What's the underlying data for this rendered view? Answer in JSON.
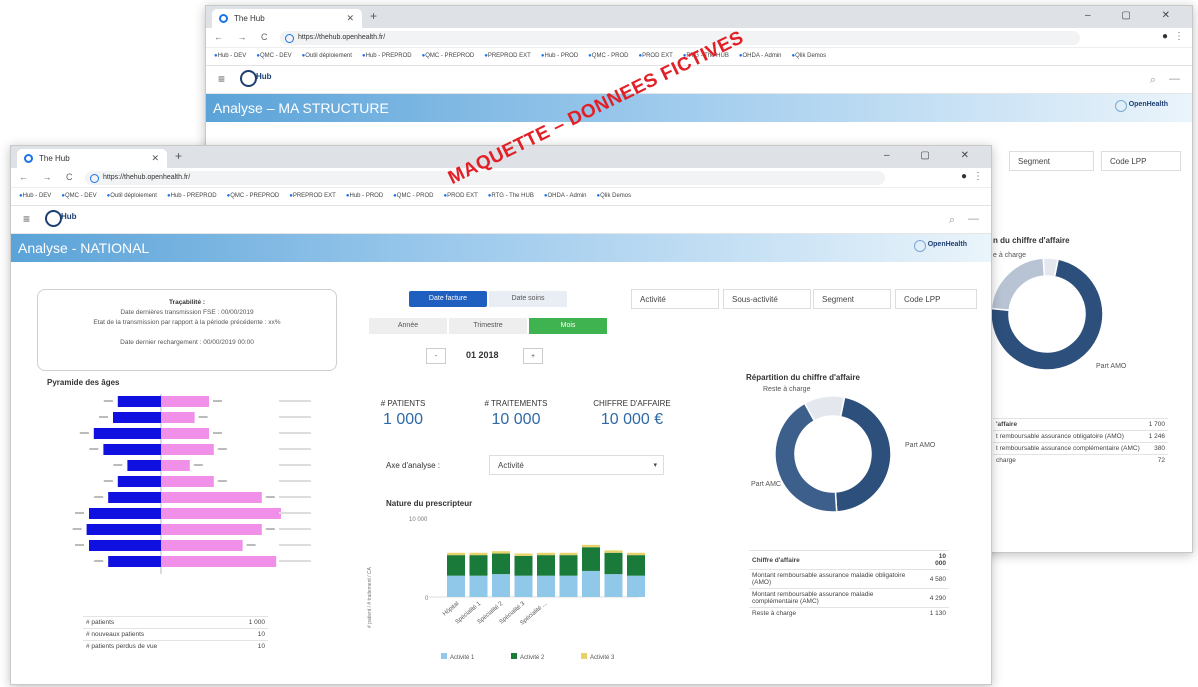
{
  "browser": {
    "tab_title": "The Hub",
    "url": "https://thehub.openhealth.fr/",
    "bookmarks": [
      "Hub - DEV",
      "QMC - DEV",
      "Outil déploiement",
      "Hub - PREPROD",
      "QMC - PREPROD",
      "PREPROD EXT",
      "Hub - PROD",
      "QMC - PROD",
      "PROD EXT",
      "RTG - The HUB",
      "OHDA - Admin",
      "Qlik Demos"
    ]
  },
  "app": {
    "logo_text": "Hub",
    "brand_text": "OpenHealth"
  },
  "back": {
    "title": "Analyse – MA STRUCTURE",
    "filters": [
      "Segment",
      "Code LPP"
    ],
    "chart_title": "n du chiffre d'affaire",
    "reste_label": "e à charge",
    "amo_label": "Part AMO",
    "table": [
      {
        "label": "'affaire",
        "value": "1 700"
      },
      {
        "label": "t remboursable assurance obligatoire (AMO)",
        "value": "1 246"
      },
      {
        "label": "t remboursable assurance complémentaire (AMC)",
        "value": "380"
      },
      {
        "label": "charge",
        "value": "72"
      }
    ]
  },
  "front": {
    "title": "Analyse - NATIONAL",
    "trace": {
      "heading": "Traçabilité :",
      "line1": "Date dernières transmission FSE : 00/00/2019",
      "line2": "Etat de la transmission par rapport à la période précédente : xx%",
      "line3": "Date dernier rechargement : 00/00/2019 00:00"
    },
    "toggle": {
      "left": "Date facture",
      "right": "Date soins"
    },
    "period": {
      "a": "Année",
      "b": "Trimestre",
      "c": "Mois"
    },
    "nav_value": "01 2018",
    "nav_prev": "-",
    "nav_next": "+",
    "filters": [
      "Activité",
      "Sous-activité",
      "Segment",
      "Code LPP"
    ],
    "pyramid_title": "Pyramide des âges",
    "kpis": [
      {
        "label": "# PATIENTS",
        "value": "1 000"
      },
      {
        "label": "# TRAITEMENTS",
        "value": "10 000"
      },
      {
        "label": "CHIFFRE D'AFFAIRE",
        "value": "10 000 €"
      }
    ],
    "axe_label": "Axe d'analyse :",
    "axe_value": "Activité",
    "presc_title": "Nature du prescripteur",
    "presc_ymax": "10 000",
    "presc_yzero": "0",
    "presc_ylabel": "# patient / # traitement / CA",
    "presc_categories": [
      "Hôpital",
      "Spécialité 1",
      "Spécialité 2",
      "Spécialité 3",
      "Spécialité ..."
    ],
    "legend": [
      "Activité 1",
      "Activité 2",
      "Activité 3"
    ],
    "repart_title": "Répartition du chiffre d'affaire",
    "reste_label": "Reste à charge",
    "amo_label": "Part AMO",
    "amc_label": "Part AMC",
    "ca_table": [
      {
        "label": "Chiffre d'affaire",
        "value": "10 000"
      },
      {
        "label": "Montant remboursable assurance maladie obligatoire (AMO)",
        "value": "4 580"
      },
      {
        "label": "Montant remboursable assurance maladie complémentaire (AMC)",
        "value": "4 290"
      },
      {
        "label": "Reste à charge",
        "value": "1 130"
      }
    ],
    "patients_table": [
      {
        "label": "# patients",
        "value": "1 000"
      },
      {
        "label": "# nouveaux patients",
        "value": "10"
      },
      {
        "label": "# patients perdus de vue",
        "value": "10"
      }
    ]
  },
  "watermark": "MAQUETTE – DONNEES FICTIVES",
  "colors": {
    "banner": "#5ba3d8",
    "navy": "#2f4f7a",
    "male": "#1010e0",
    "female": "#f090e8",
    "act1": "#8fc8e8",
    "act2": "#1a7a3a",
    "act3": "#e6d36a",
    "green_btn": "#3fb34f",
    "blue_btn": "#1f5fbf"
  },
  "chart_data": [
    {
      "type": "bar",
      "title": "Pyramide des âges",
      "series": [
        {
          "values": [
            18,
            20,
            28,
            24,
            14,
            18,
            22,
            30,
            31,
            30,
            22
          ]
        },
        {
          "values": [
            20,
            14,
            20,
            22,
            12,
            22,
            42,
            50,
            42,
            34,
            48
          ]
        }
      ]
    },
    {
      "type": "bar",
      "title": "Nature du prescripteur",
      "categories": [
        "Hôpital",
        "Spécialité 1",
        "Spécialité 2",
        "Spécialité 3",
        "Spécialité ..."
      ],
      "ylim": [
        0,
        10000
      ],
      "series": [
        {
          "name": "Activité 1",
          "values": [
            2700,
            2700,
            2900,
            2700,
            2700,
            2700,
            3300,
            2900,
            2700
          ]
        },
        {
          "name": "Activité 2",
          "values": [
            2600,
            2600,
            2600,
            2500,
            2600,
            2600,
            3000,
            2700,
            2600
          ]
        },
        {
          "name": "Activité 3",
          "values": [
            300,
            300,
            300,
            300,
            300,
            300,
            300,
            300,
            300
          ]
        }
      ]
    },
    {
      "type": "pie",
      "title": "Répartition du chiffre d'affaire",
      "series": [
        {
          "values": [
            4580,
            4290,
            1130
          ]
        }
      ]
    },
    {
      "type": "pie",
      "series": [
        {
          "values": [
            1246,
            380,
            72
          ]
        }
      ]
    }
  ]
}
